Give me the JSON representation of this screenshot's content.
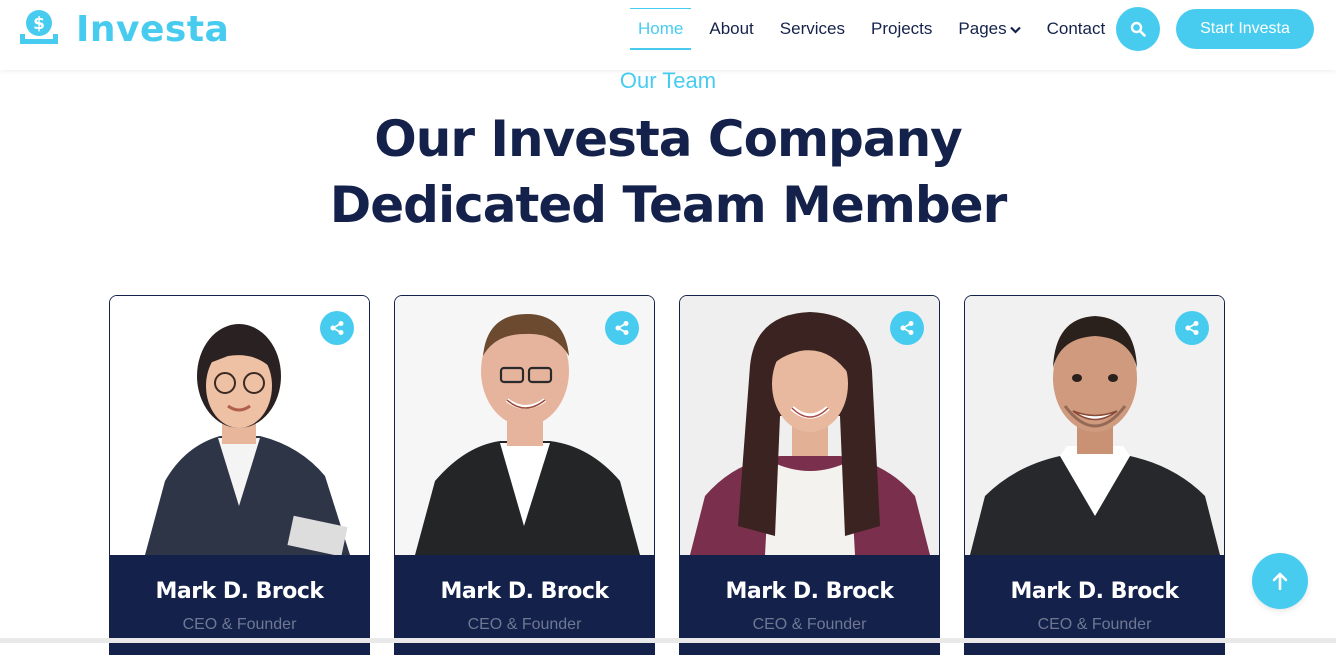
{
  "brand": {
    "name": "Investa",
    "color": "#47ccf0",
    "icon": "dollar-hand-icon"
  },
  "nav": {
    "items": [
      {
        "label": "Home",
        "active": true
      },
      {
        "label": "About"
      },
      {
        "label": "Services"
      },
      {
        "label": "Projects"
      },
      {
        "label": "Pages",
        "dropdown": true
      },
      {
        "label": "Contact"
      }
    ],
    "search_icon": "search-icon",
    "cta_label": "Start Investa"
  },
  "section": {
    "kicker": "Our Team",
    "title_line1": "Our Investa Company",
    "title_line2": "Dedicated Team Member"
  },
  "team": [
    {
      "name": "Mark D. Brock",
      "role": "CEO & Founder",
      "photo": "woman-glasses-portrait"
    },
    {
      "name": "Mark D. Brock",
      "role": "CEO & Founder",
      "photo": "man-glasses-portrait"
    },
    {
      "name": "Mark D. Brock",
      "role": "CEO & Founder",
      "photo": "woman-long-hair-portrait"
    },
    {
      "name": "Mark D. Brock",
      "role": "CEO & Founder",
      "photo": "man-short-hair-portrait"
    }
  ],
  "colors": {
    "accent": "#47ccf0",
    "navy": "#13214b",
    "role_text": "#6f7893"
  },
  "scroll_top_icon": "arrow-up-icon"
}
